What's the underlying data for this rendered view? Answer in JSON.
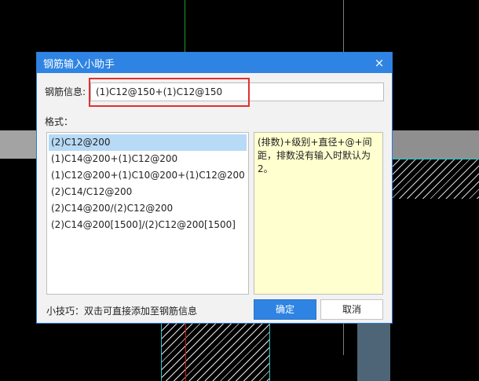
{
  "dialog": {
    "title": "钢筋输入小助手",
    "close_symbol": "×",
    "info_label": "钢筋信息:",
    "info_value": "(1)C12@150+(1)C12@150",
    "format_label": "格式：",
    "formats": [
      "(2)C12@200",
      "(1)C14@200+(1)C12@200",
      "(1)C12@200+(1)C10@200+(1)C12@200",
      "(2)C14/C12@200",
      "(2)C14@200/(2)C12@200",
      "(2)C14@200[1500]/(2)C12@200[1500]"
    ],
    "selected_index": 0,
    "description": "(排数)+级别+直径+@+间距，排数没有输入时默认为2。",
    "tip": "小技巧：双击可直接添加至钢筋信息",
    "ok_label": "确定",
    "cancel_label": "取消"
  },
  "colors": {
    "titlebar": "#2f84e3",
    "selection": "#b7daf6",
    "description_bg": "#ffffd0",
    "highlight": "#e03030"
  }
}
